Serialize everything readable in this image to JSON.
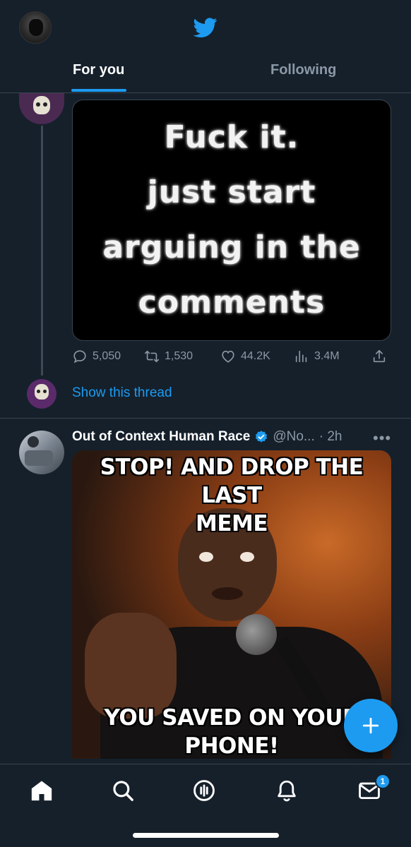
{
  "header": {
    "tabs": [
      {
        "label": "For you",
        "active": true
      },
      {
        "label": "Following",
        "active": false
      }
    ]
  },
  "thread_post": {
    "image_text": "Fuck it.\njust start\narguing in the\ncomments",
    "actions": {
      "replies": "5,050",
      "retweets": "1,530",
      "likes": "44.2K",
      "views": "3.4M"
    },
    "show_thread_label": "Show this thread"
  },
  "post": {
    "name": "Out of Context Human Race",
    "handle": "@No...",
    "time": "· 2h",
    "more": "•••",
    "image_top_text": "STOP! AND DROP THE LAST\nMEME",
    "image_bottom_text": "YOU SAVED ON YOUR PHONE!"
  },
  "fab": {
    "icon": "plus-icon"
  },
  "bottom_nav": {
    "items": [
      "home-icon",
      "search-icon",
      "spaces-icon",
      "notifications-icon",
      "messages-icon"
    ],
    "messages_badge": "1"
  },
  "colors": {
    "background": "#15202b",
    "accent": "#1d9bf0",
    "muted": "#8b98a5",
    "border": "#38444d"
  }
}
